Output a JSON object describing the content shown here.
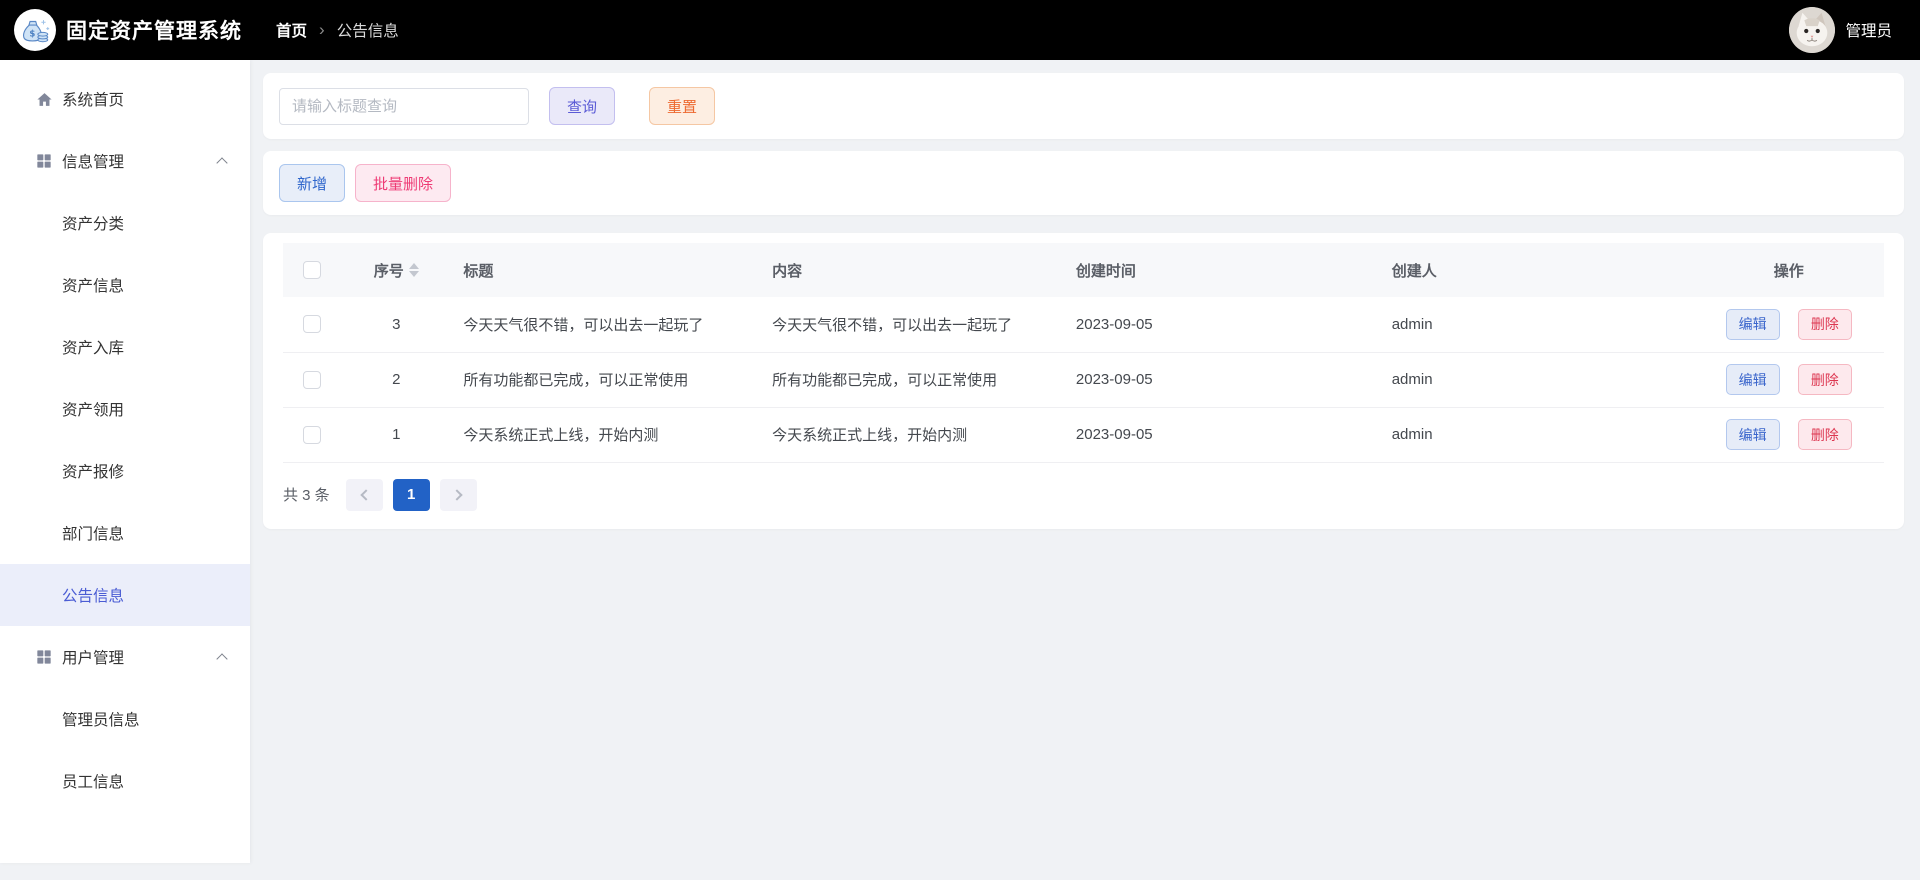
{
  "header": {
    "app_title": "固定资产管理系统",
    "breadcrumb": {
      "home": "首页",
      "separator": "›",
      "current": "公告信息"
    },
    "user_name": "管理员"
  },
  "sidebar": {
    "items": [
      {
        "id": "home",
        "kind": "home",
        "label": "系统首页",
        "icon": "home-icon"
      },
      {
        "id": "info-mgmt",
        "kind": "group",
        "label": "信息管理",
        "icon": "grid-icon",
        "expanded": true
      },
      {
        "id": "asset-category",
        "kind": "child",
        "label": "资产分类"
      },
      {
        "id": "asset-info",
        "kind": "child",
        "label": "资产信息"
      },
      {
        "id": "asset-inbound",
        "kind": "child",
        "label": "资产入库"
      },
      {
        "id": "asset-use",
        "kind": "child",
        "label": "资产领用"
      },
      {
        "id": "asset-repair",
        "kind": "child",
        "label": "资产报修"
      },
      {
        "id": "dept-info",
        "kind": "child",
        "label": "部门信息"
      },
      {
        "id": "notice-info",
        "kind": "child",
        "label": "公告信息",
        "active": true
      },
      {
        "id": "user-mgmt",
        "kind": "group",
        "label": "用户管理",
        "icon": "grid-icon",
        "expanded": true
      },
      {
        "id": "admin-info",
        "kind": "child",
        "label": "管理员信息"
      },
      {
        "id": "employee-info",
        "kind": "child",
        "label": "员工信息"
      }
    ]
  },
  "search": {
    "placeholder": "请输入标题查询",
    "value": "",
    "query_label": "查询",
    "reset_label": "重置"
  },
  "toolbar": {
    "add_label": "新增",
    "batch_delete_label": "批量删除"
  },
  "table": {
    "columns": [
      "序号",
      "标题",
      "内容",
      "创建时间",
      "创建人",
      "操作"
    ],
    "edit_label": "编辑",
    "delete_label": "删除",
    "rows": [
      {
        "seq": "3",
        "title": "今天天气很不错，可以出去一起玩了",
        "content": "今天天气很不错，可以出去一起玩了",
        "created_at": "2023-09-05",
        "creator": "admin"
      },
      {
        "seq": "2",
        "title": "所有功能都已完成，可以正常使用",
        "content": "所有功能都已完成，可以正常使用",
        "created_at": "2023-09-05",
        "creator": "admin"
      },
      {
        "seq": "1",
        "title": "今天系统正式上线，开始内测",
        "content": "今天系统正式上线，开始内测",
        "created_at": "2023-09-05",
        "creator": "admin"
      }
    ]
  },
  "pagination": {
    "total_text": "共 3 条",
    "current_page": "1"
  },
  "colors": {
    "header_bg": "#000000",
    "page_bg": "#f0f2f5",
    "active_menu_bg": "#ebeefa",
    "active_menu_text": "#4a5cd4",
    "pagination_active": "#2262c6",
    "query_btn_text": "#5b5bd6",
    "reset_btn_text": "#ed6a31",
    "add_btn_text": "#2f66cc",
    "batch_delete_text": "#ee3b75",
    "edit_btn_text": "#3b66cc",
    "delete_btn_text": "#dd3751"
  }
}
